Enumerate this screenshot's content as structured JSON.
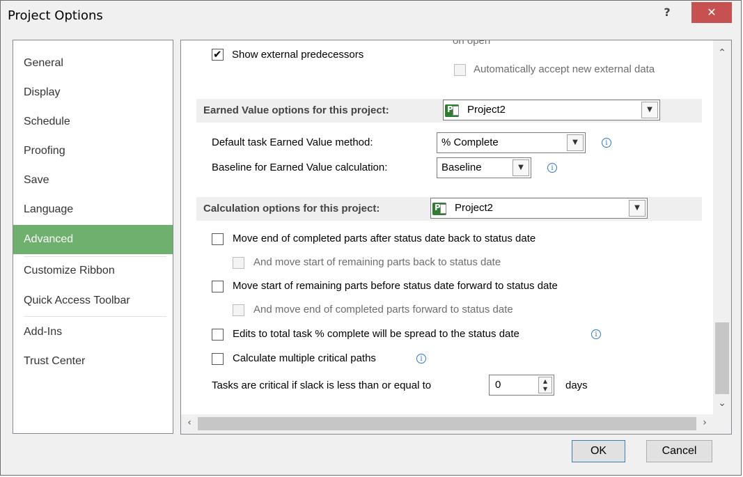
{
  "window": {
    "title": "Project Options",
    "help_label": "?",
    "close_label": "✕"
  },
  "nav": {
    "items": [
      {
        "label": "General"
      },
      {
        "label": "Display"
      },
      {
        "label": "Schedule"
      },
      {
        "label": "Proofing"
      },
      {
        "label": "Save"
      },
      {
        "label": "Language"
      },
      {
        "label": "Advanced",
        "selected": true
      },
      {
        "label": "Customize Ribbon"
      },
      {
        "label": "Quick Access Toolbar"
      },
      {
        "label": "Add-Ins"
      },
      {
        "label": "Trust Center"
      }
    ]
  },
  "content": {
    "top": {
      "show_external_predecessors": {
        "label": "Show external predecessors",
        "checked": true
      },
      "on_open_fragment": "on open",
      "auto_accept": {
        "label": "Automatically accept new external data",
        "checked": false,
        "disabled": true
      }
    },
    "earned_value": {
      "header": "Earned Value options for this project:",
      "project": "Project2",
      "default_method_label": "Default task Earned Value method:",
      "default_method_value": "% Complete",
      "baseline_label": "Baseline for Earned Value calculation:",
      "baseline_value": "Baseline"
    },
    "calculation": {
      "header": "Calculation options for this project:",
      "project": "Project2",
      "options": [
        {
          "label": "Move end of completed parts after status date back to status date",
          "checked": false
        },
        {
          "label": "And move start of remaining parts back to status date",
          "checked": false,
          "disabled": true
        },
        {
          "label": "Move start of remaining parts before status date forward to status date",
          "checked": false
        },
        {
          "label": "And move end of completed parts forward to status date",
          "checked": false,
          "disabled": true
        },
        {
          "label": "Edits to total task % complete will be spread to the status date",
          "checked": false
        },
        {
          "label": "Calculate multiple critical paths",
          "checked": false
        }
      ],
      "critical_label": "Tasks are critical if slack is less than or equal to",
      "critical_value": "0",
      "critical_unit": "days"
    }
  },
  "buttons": {
    "ok": "OK",
    "cancel": "Cancel"
  },
  "colors": {
    "selected_nav": "#6fb06f",
    "close_button": "#c75050",
    "info_icon": "#2e74c8"
  }
}
